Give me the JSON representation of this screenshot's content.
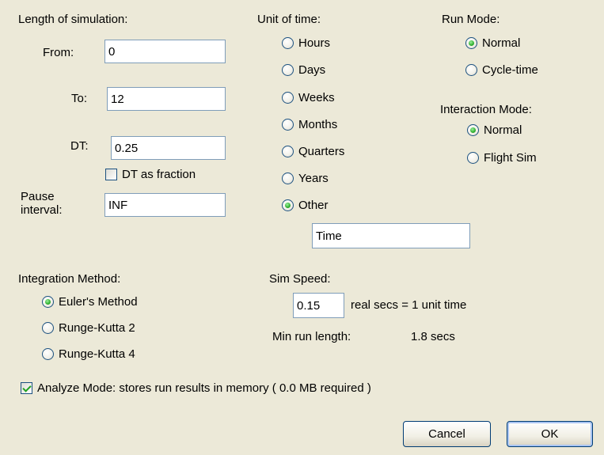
{
  "length": {
    "heading": "Length of simulation:",
    "from_label": "From:",
    "from_value": "0",
    "to_label": "To:",
    "to_value": "12",
    "dt_label": "DT:",
    "dt_value": "0.25",
    "dt_fraction_label": "DT as fraction",
    "dt_fraction_checked": false,
    "pause_label_line1": "Pause",
    "pause_label_line2": "interval:",
    "pause_value": "INF"
  },
  "unit_of_time": {
    "heading": "Unit of time:",
    "options": [
      "Hours",
      "Days",
      "Weeks",
      "Months",
      "Quarters",
      "Years",
      "Other"
    ],
    "selected": "Other",
    "other_value": "Time"
  },
  "run_mode": {
    "heading": "Run Mode:",
    "options": [
      "Normal",
      "Cycle-time"
    ],
    "selected": "Normal"
  },
  "interaction_mode": {
    "heading": "Interaction Mode:",
    "options": [
      "Normal",
      "Flight Sim"
    ],
    "selected": "Normal"
  },
  "integration": {
    "heading": "Integration Method:",
    "options": [
      "Euler's Method",
      "Runge-Kutta 2",
      "Runge-Kutta 4"
    ],
    "selected": "Euler's Method"
  },
  "sim_speed": {
    "heading": "Sim Speed:",
    "value": "0.15",
    "suffix": "real secs = 1 unit time",
    "min_run_label": "Min run length:",
    "min_run_value": "1.8 secs"
  },
  "analyze": {
    "label": "Analyze Mode: stores run results in memory ( 0.0 MB required )",
    "checked": true
  },
  "buttons": {
    "cancel": "Cancel",
    "ok": "OK"
  }
}
